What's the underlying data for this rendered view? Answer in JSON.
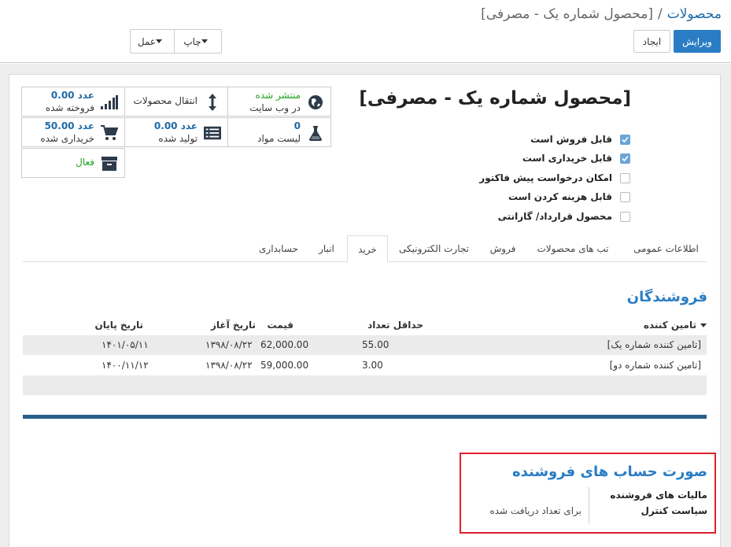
{
  "breadcrumb": {
    "parent": "محصولات",
    "separator": "/",
    "current": "[محصول شماره یک - مصرفی]"
  },
  "toolbar": {
    "edit_label": "ویرایش",
    "create_label": "ایجاد",
    "print_label": "چاپ",
    "action_label": "عمل"
  },
  "product": {
    "title": "[محصول شماره یک - مصرفی]"
  },
  "stat_buttons": {
    "published": {
      "line1": "منتشر شده",
      "line2": "در وب سایت",
      "color": "#21a421"
    },
    "moves": {
      "label": "انتقال محصولات"
    },
    "sold": {
      "value": "0.00 عدد",
      "label": "فروخته شده"
    },
    "bom": {
      "value": "0",
      "label": "لیست مواد"
    },
    "produced": {
      "value": "0.00 عدد",
      "label": "تولید شده"
    },
    "purchased": {
      "value": "50.00 عدد",
      "label": "خریداری شده"
    },
    "active": {
      "label": "فعال",
      "color": "#21a421"
    }
  },
  "checkboxes": [
    {
      "label": "قابل فروش است",
      "checked": true
    },
    {
      "label": "قابل خریداری است",
      "checked": true
    },
    {
      "label": "امکان درخواست پیش فاکتور",
      "checked": false
    },
    {
      "label": "قابل هزینه کردن است",
      "checked": false
    },
    {
      "label": "محصول قرارداد/ گارانتی",
      "checked": false
    }
  ],
  "tabs": [
    "اطلاعات عمومی",
    "تب های محصولات",
    "فروش",
    "تجارت الکترونیکی",
    "خرید",
    "انبار",
    "حسابداری"
  ],
  "active_tab": "خرید",
  "vendors": {
    "heading": "فروشندگان",
    "columns": {
      "vendor": "تامین کننده",
      "min_qty": "حداقل تعداد",
      "price": "قیمت",
      "start": "تاریخ آغاز",
      "end": "تاریخ پایان"
    },
    "rows": [
      {
        "vendor": "[تامین کننده شماره یک]",
        "min_qty": "55.00",
        "price": "62,000.00",
        "start": "۱۳۹۸/۰۸/۲۲",
        "end": "۱۴۰۱/۰۵/۱۱"
      },
      {
        "vendor": "[تامین کننده شماره دو]",
        "min_qty": "3.00",
        "price": "59,000.00",
        "start": "۱۳۹۸/۰۸/۲۲",
        "end": "۱۴۰۰/۱۱/۱۲"
      }
    ]
  },
  "vendor_bills": {
    "heading": "صورت حساب های فروشنده",
    "taxes_label": "مالیات های فروشنده",
    "control_label": "سیاست کنترل",
    "control_value": "برای تعداد دریافت شده"
  },
  "colors": {
    "accent": "#2a7dc5",
    "highlight_box": "#e0202b",
    "separator_bar": "#265c8a"
  }
}
